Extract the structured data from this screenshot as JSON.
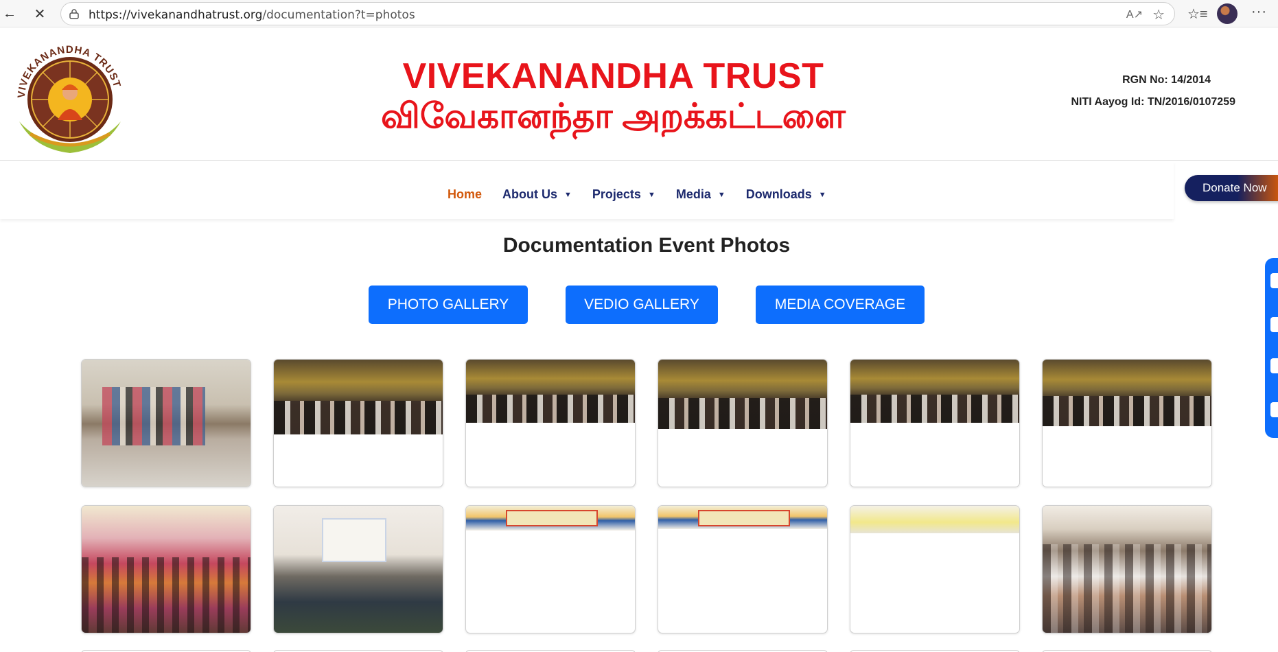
{
  "browser": {
    "url_host": "https://vivekanandhatrust.org",
    "url_path": "/documentation?t=photos",
    "icons": [
      "back-arrow-icon",
      "close-icon",
      "lock-icon",
      "read-aloud-icon",
      "star-icon",
      "favorites-icon",
      "profile-avatar",
      "more-icon"
    ]
  },
  "header": {
    "logo_text": "VIVEKANANDHA TRUST",
    "title_en": "VIVEKANANDHA TRUST",
    "title_ta": "விவேகானந்தா அறக்கட்டளை",
    "rgn": "RGN No: 14/2014",
    "niti": "NITI Aayog Id: TN/2016/0107259"
  },
  "nav": {
    "items": [
      {
        "label": "Home",
        "active": true
      },
      {
        "label": "About Us",
        "dropdown": true
      },
      {
        "label": "Projects",
        "dropdown": true
      },
      {
        "label": "Media",
        "dropdown": true
      },
      {
        "label": "Downloads",
        "dropdown": true
      }
    ],
    "donate_label": "Donate Now"
  },
  "page": {
    "title": "Documentation Event Photos",
    "buttons": [
      "PHOTO GALLERY",
      "VEDIO GALLERY",
      "MEDIA COVERAGE"
    ]
  },
  "colors": {
    "brand_red": "#e8141b",
    "nav_blue": "#1d2a6e",
    "nav_active": "#d2580b",
    "button_blue": "#0d6efd"
  },
  "social": {
    "icons": [
      "facebook-icon",
      "twitter-icon",
      "whatsapp-icon",
      "instagram-icon"
    ]
  },
  "gallery": {
    "row_count_visible": 2,
    "columns": 6
  }
}
